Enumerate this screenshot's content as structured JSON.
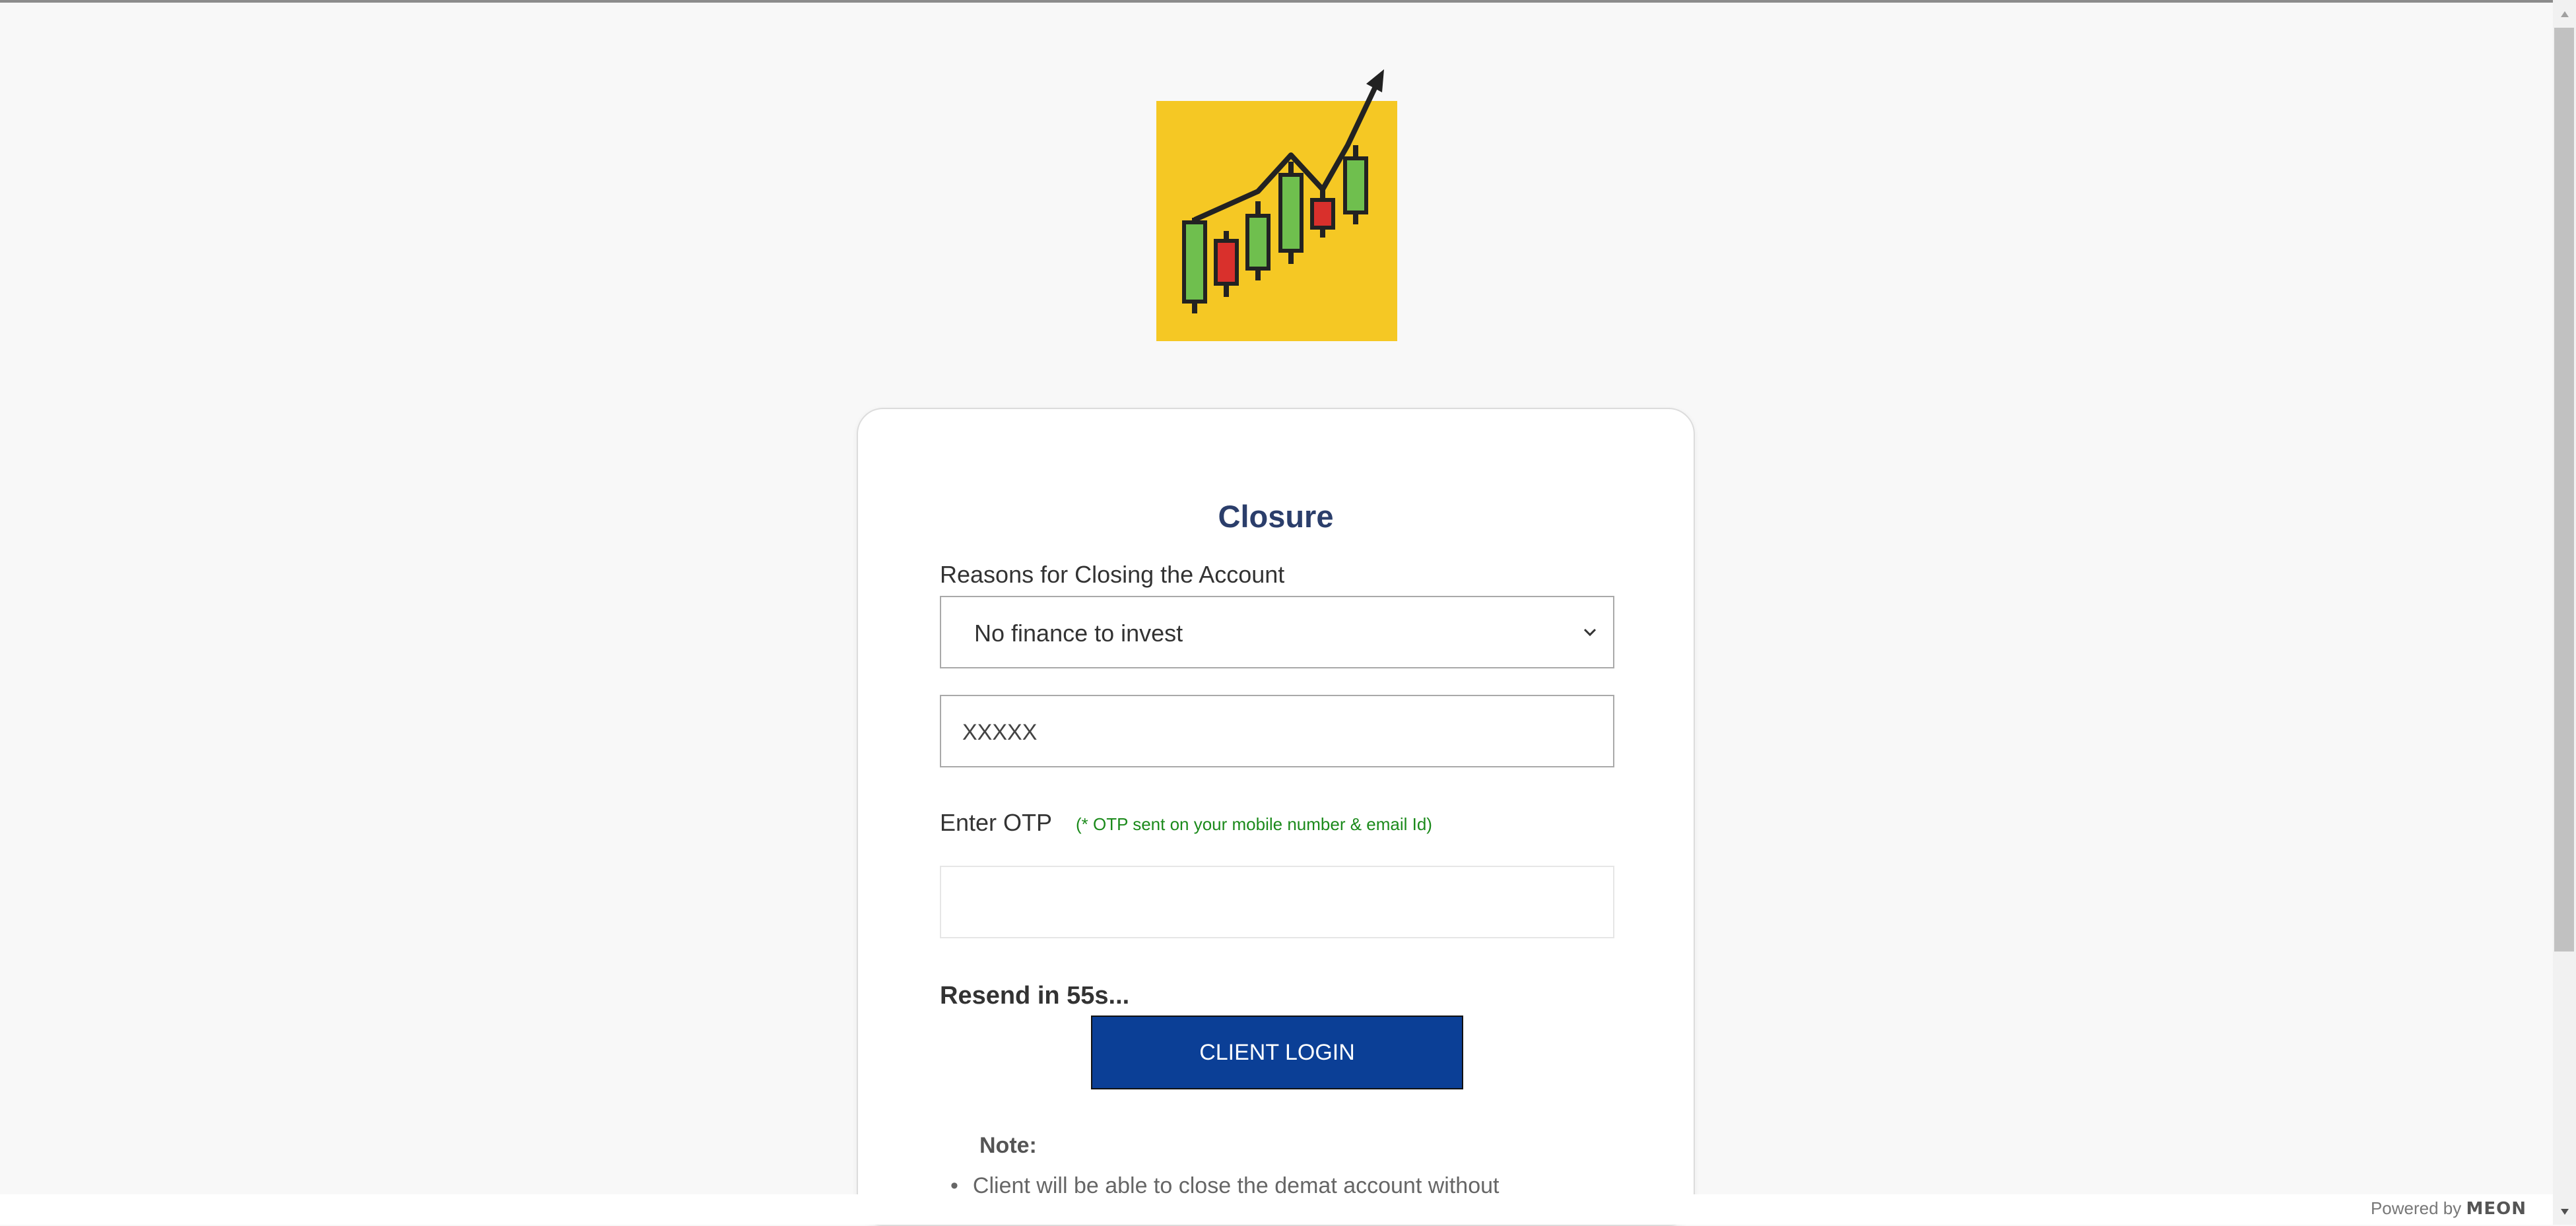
{
  "logo": {
    "icon": "candlestick-chart-icon",
    "bg_color": "#f5c824"
  },
  "form": {
    "title": "Closure",
    "reason_label": "Reasons for Closing the Account",
    "reason_selected": "No finance to invest",
    "client_id_value": "XXXXX",
    "otp_label": "Enter OTP",
    "otp_hint": "(* OTP sent on your mobile number & email Id)",
    "otp_value": "",
    "resend_text": "Resend in 55s...",
    "login_button": "CLIENT LOGIN"
  },
  "note": {
    "title": "Note:",
    "items": [
      "Client will be able to close the demat account without"
    ]
  },
  "footer": {
    "powered_by": "Powered by",
    "brand": "MEON"
  },
  "colors": {
    "accent": "#0b3f96",
    "title": "#2b3e6b",
    "hint": "#1b8a1b"
  }
}
